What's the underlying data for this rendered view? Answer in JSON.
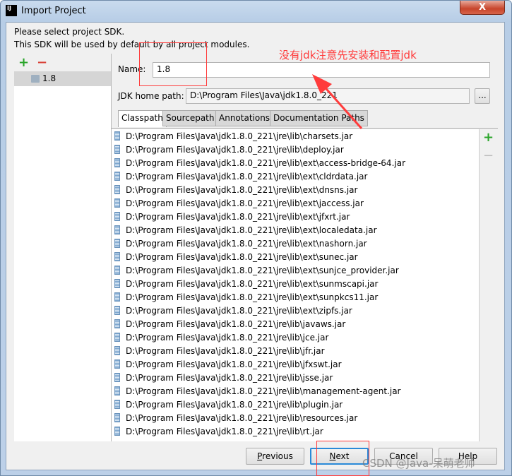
{
  "window": {
    "title": "Import Project",
    "close_label": "X",
    "app_icon": "IJ"
  },
  "intro": {
    "line1": "Please select project SDK.",
    "line2": "This SDK will be used by default by all project modules."
  },
  "sdk_list": {
    "add_icon": "+",
    "remove_icon": "−",
    "items": [
      {
        "label": "1.8",
        "selected": true
      }
    ]
  },
  "form": {
    "name_label": "Name:",
    "name_value": "1.8",
    "home_label": "JDK home path:",
    "home_value": "D:\\Program Files\\Java\\jdk1.8.0_221",
    "browse_label": "..."
  },
  "tabs": [
    {
      "label": "Classpath",
      "active": true
    },
    {
      "label": "Sourcepath"
    },
    {
      "label": "Annotations"
    },
    {
      "label": "Documentation Paths"
    }
  ],
  "classpath": [
    "D:\\Program Files\\Java\\jdk1.8.0_221\\jre\\lib\\charsets.jar",
    "D:\\Program Files\\Java\\jdk1.8.0_221\\jre\\lib\\deploy.jar",
    "D:\\Program Files\\Java\\jdk1.8.0_221\\jre\\lib\\ext\\access-bridge-64.jar",
    "D:\\Program Files\\Java\\jdk1.8.0_221\\jre\\lib\\ext\\cldrdata.jar",
    "D:\\Program Files\\Java\\jdk1.8.0_221\\jre\\lib\\ext\\dnsns.jar",
    "D:\\Program Files\\Java\\jdk1.8.0_221\\jre\\lib\\ext\\jaccess.jar",
    "D:\\Program Files\\Java\\jdk1.8.0_221\\jre\\lib\\ext\\jfxrt.jar",
    "D:\\Program Files\\Java\\jdk1.8.0_221\\jre\\lib\\ext\\localedata.jar",
    "D:\\Program Files\\Java\\jdk1.8.0_221\\jre\\lib\\ext\\nashorn.jar",
    "D:\\Program Files\\Java\\jdk1.8.0_221\\jre\\lib\\ext\\sunec.jar",
    "D:\\Program Files\\Java\\jdk1.8.0_221\\jre\\lib\\ext\\sunjce_provider.jar",
    "D:\\Program Files\\Java\\jdk1.8.0_221\\jre\\lib\\ext\\sunmscapi.jar",
    "D:\\Program Files\\Java\\jdk1.8.0_221\\jre\\lib\\ext\\sunpkcs11.jar",
    "D:\\Program Files\\Java\\jdk1.8.0_221\\jre\\lib\\ext\\zipfs.jar",
    "D:\\Program Files\\Java\\jdk1.8.0_221\\jre\\lib\\javaws.jar",
    "D:\\Program Files\\Java\\jdk1.8.0_221\\jre\\lib\\jce.jar",
    "D:\\Program Files\\Java\\jdk1.8.0_221\\jre\\lib\\jfr.jar",
    "D:\\Program Files\\Java\\jdk1.8.0_221\\jre\\lib\\jfxswt.jar",
    "D:\\Program Files\\Java\\jdk1.8.0_221\\jre\\lib\\jsse.jar",
    "D:\\Program Files\\Java\\jdk1.8.0_221\\jre\\lib\\management-agent.jar",
    "D:\\Program Files\\Java\\jdk1.8.0_221\\jre\\lib\\plugin.jar",
    "D:\\Program Files\\Java\\jdk1.8.0_221\\jre\\lib\\resources.jar",
    "D:\\Program Files\\Java\\jdk1.8.0_221\\jre\\lib\\rt.jar"
  ],
  "side_buttons": {
    "add": "+",
    "remove": "−"
  },
  "buttons": {
    "previous": "Previous",
    "next": "Next",
    "cancel": "Cancel",
    "help": "Help"
  },
  "annotation": {
    "text": "没有jdk注意先安装和配置jdk",
    "color": "#ff3b3b"
  },
  "watermark": "CSDN @Java-呆萌老师"
}
